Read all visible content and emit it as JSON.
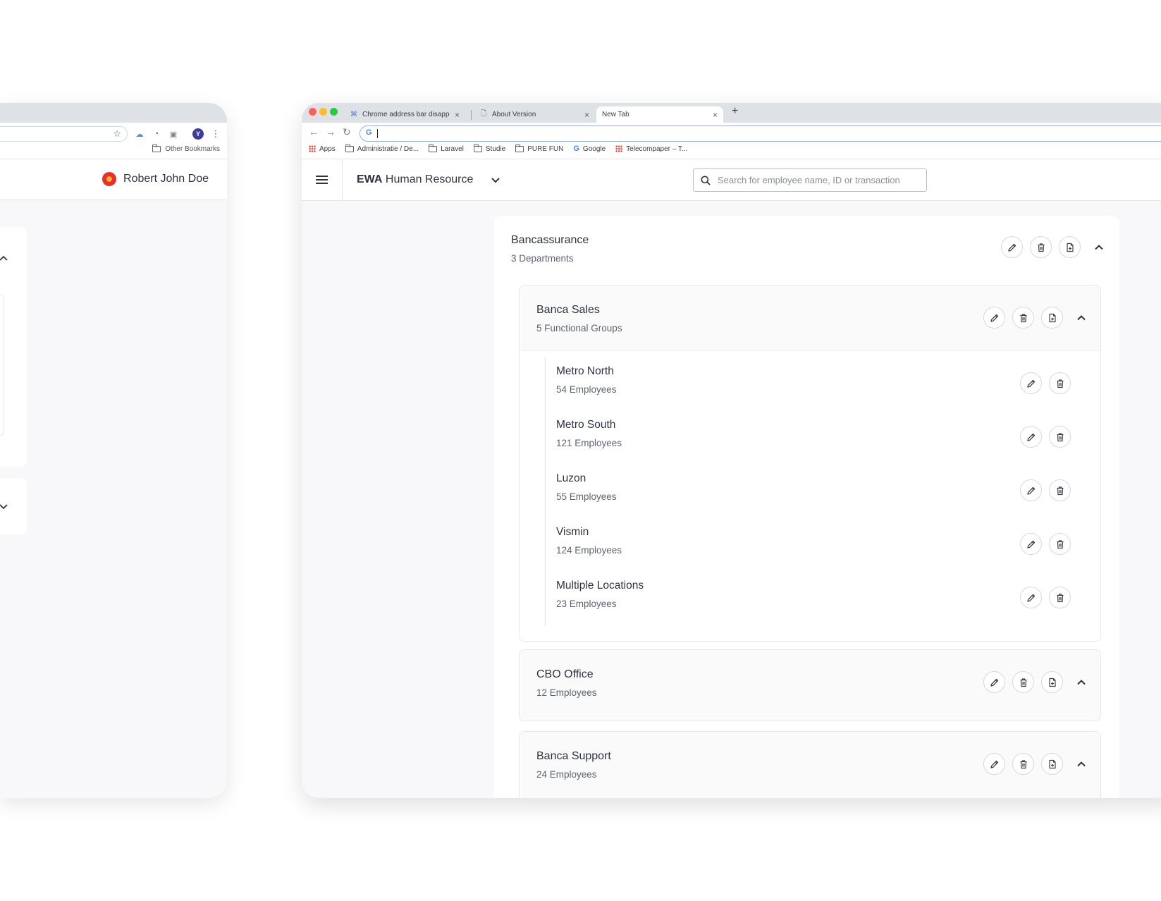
{
  "left_window": {
    "other_bookmarks": "Other Bookmarks",
    "avatar_letter": "Y",
    "user_name": "Robert John Doe"
  },
  "browser": {
    "tabs": [
      {
        "label": "Chrome address bar disappea",
        "active": false
      },
      {
        "label": "About Version",
        "active": false
      },
      {
        "label": "New Tab",
        "active": true
      }
    ],
    "bookmarks": [
      {
        "label": "Apps",
        "icon": "apps-grid-icon"
      },
      {
        "label": "Administratie / De...",
        "icon": "folder-icon"
      },
      {
        "label": "Laravel",
        "icon": "folder-icon"
      },
      {
        "label": "Studie",
        "icon": "folder-icon"
      },
      {
        "label": "PURE FUN",
        "icon": "folder-icon"
      },
      {
        "label": "Google",
        "icon": "google-icon"
      },
      {
        "label": "Telecompaper – T...",
        "icon": "apps-grid-icon"
      }
    ]
  },
  "app": {
    "brand_bold": "EWA",
    "brand_rest": "Human Resource",
    "search_placeholder": "Search for employee name, ID or transaction"
  },
  "division": {
    "name": "Bancassurance",
    "subtitle": "3 Departments"
  },
  "departments": [
    {
      "name": "Banca Sales",
      "subtitle": "5 Functional Groups",
      "expanded": true,
      "groups": [
        {
          "name": "Metro North",
          "subtitle": "54 Employees"
        },
        {
          "name": "Metro South",
          "subtitle": "121 Employees"
        },
        {
          "name": "Luzon",
          "subtitle": "55 Employees"
        },
        {
          "name": "Vismin",
          "subtitle": "124 Employees"
        },
        {
          "name": "Multiple Locations",
          "subtitle": "23 Employees"
        }
      ]
    },
    {
      "name": "CBO Office",
      "subtitle": "12 Employees",
      "expanded": false
    },
    {
      "name": "Banca Support",
      "subtitle": "24 Employees",
      "expanded": false
    }
  ],
  "colors": {
    "text": "#2f3340",
    "muted": "#5e6370",
    "page_bg": "#f8f8fa",
    "chrome_tabbar": "#dee1e6",
    "traffic_red": "#fe5f57",
    "traffic_yellow": "#febc2e",
    "traffic_green": "#28c840"
  }
}
